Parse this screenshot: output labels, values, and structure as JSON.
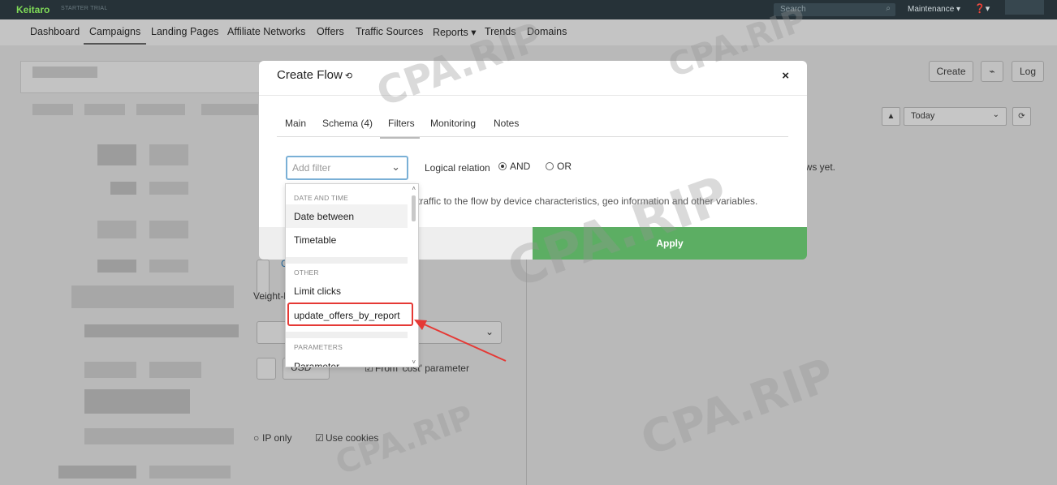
{
  "topbar": {
    "logo": "Keitaro",
    "plan": "STARTER TRIAL",
    "search_placeholder": "Search",
    "maintenance": "Maintenance ▾",
    "help": "❓▾"
  },
  "nav": [
    "Dashboard",
    "Campaigns",
    "Landing Pages",
    "Affiliate Networks",
    "Offers",
    "Traffic Sources",
    "Reports ▾",
    "Trends",
    "Domains"
  ],
  "header_buttons": {
    "create": "Create",
    "link": "⌁",
    "log": "Log"
  },
  "date_filter": {
    "value": "Today"
  },
  "background": {
    "no_flows_fragment": "ows yet.",
    "weight_fragment": "Veight-b",
    "currency": "USD",
    "cost_param": "From 'cost' parameter",
    "ip_only": "IP only",
    "use_cookies": "Use cookies"
  },
  "modal": {
    "title": "Create Flow",
    "tabs": [
      "Main",
      "Schema (4)",
      "Filters",
      "Monitoring",
      "Notes"
    ],
    "active_tab": "Filters",
    "filter_placeholder": "Add filter",
    "logical_relation_label": "Logical relation",
    "and_label": "AND",
    "or_label": "OR",
    "hint": "traffic to the flow by device characteristics, geo information and other variables.",
    "apply": "Apply"
  },
  "dropdown": {
    "group_date": "DATE AND TIME",
    "date_between": "Date between",
    "timetable": "Timetable",
    "group_other": "OTHER",
    "limit_clicks": "Limit clicks",
    "update_offers": "update_offers_by_report",
    "group_params": "PARAMETERS",
    "parameter": "Parameter"
  },
  "watermark": "CPA.RIP",
  "colors": {
    "accent_green": "#5cae63",
    "highlight_red": "#e53935",
    "topbar": "#263238"
  }
}
